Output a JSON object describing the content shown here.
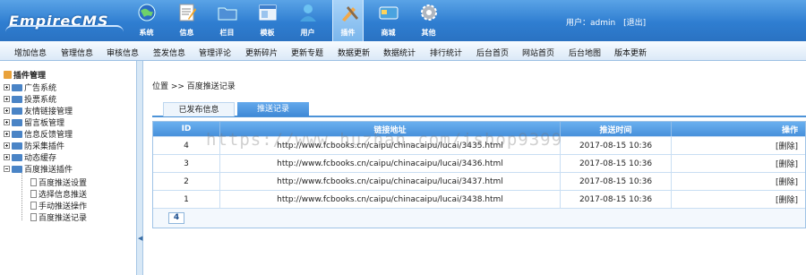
{
  "header": {
    "logo_text": "EmpireCMS",
    "modules": [
      {
        "label": "系统",
        "icon": "globe-icon"
      },
      {
        "label": "信息",
        "icon": "notepad-icon"
      },
      {
        "label": "栏目",
        "icon": "folder-icon"
      },
      {
        "label": "模板",
        "icon": "window-icon"
      },
      {
        "label": "用户",
        "icon": "user-icon"
      },
      {
        "label": "插件",
        "icon": "tools-icon"
      },
      {
        "label": "商城",
        "icon": "card-icon"
      },
      {
        "label": "其他",
        "icon": "gear-icon"
      }
    ],
    "active_module": "插件",
    "user_text": "用户：admin",
    "logout_label": "[退出]"
  },
  "menubar": {
    "items": [
      "增加信息",
      "管理信息",
      "审核信息",
      "签发信息",
      "管理评论",
      "更新碎片",
      "更新专题",
      "数据更新",
      "数据统计",
      "排行统计",
      "后台首页",
      "网站首页",
      "后台地图",
      "版本更新"
    ]
  },
  "tree": {
    "title": "插件管理",
    "nodes": [
      "广告系统",
      "投票系统",
      "友情链接管理",
      "留言板管理",
      "信息反馈管理",
      "防采集插件",
      "动态缓存",
      "百度推送插件"
    ],
    "leaves": [
      "百度推送设置",
      "选择信息推送",
      "手动推送操作",
      "百度推送记录"
    ]
  },
  "main": {
    "breadcrumb": "位置 >> 百度推送记录",
    "tabs": [
      "已发布信息",
      "推送记录"
    ],
    "table": {
      "headers": [
        "ID",
        "链接地址",
        "推送时间",
        "操作"
      ],
      "rows": [
        {
          "id": "4",
          "url": "http://www.fcbooks.cn/caipu/chinacaipu/lucai/3435.html",
          "time": "2017-08-15 10:36",
          "action": "[删除]"
        },
        {
          "id": "3",
          "url": "http://www.fcbooks.cn/caipu/chinacaipu/lucai/3436.html",
          "time": "2017-08-15 10:36",
          "action": "[删除]"
        },
        {
          "id": "2",
          "url": "http://www.fcbooks.cn/caipu/chinacaipu/lucai/3437.html",
          "time": "2017-08-15 10:36",
          "action": "[删除]"
        },
        {
          "id": "1",
          "url": "http://www.fcbooks.cn/caipu/chinacaipu/lucai/3438.html",
          "time": "2017-08-15 10:36",
          "action": "[删除]"
        }
      ],
      "page": "4"
    }
  },
  "watermark": "https://www.huzhan.com/ishop9399",
  "colors": {
    "header_blue": "#2f7ed1",
    "grid_header": "#4790db",
    "tab_active": "#3f89d6"
  }
}
